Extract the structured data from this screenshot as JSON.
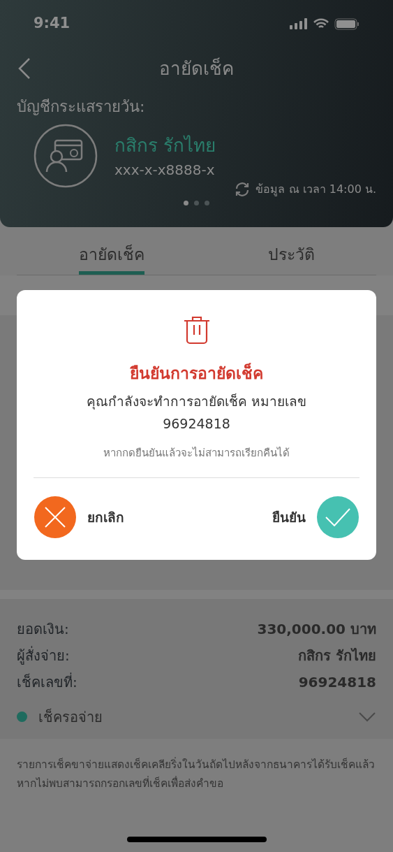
{
  "status_bar": {
    "time": "9:41"
  },
  "header": {
    "title": "อายัดเช็ค",
    "account_label": "บัญชีกระแสรายวัน:",
    "account_name": "กสิกร รักไทย",
    "account_number": "xxx-x-x8888-x",
    "updated": "ข้อมูล ณ เวลา 14:00 น.",
    "pages": [
      {
        "selected": true
      },
      {
        "selected": false
      },
      {
        "selected": false
      }
    ]
  },
  "tabs": [
    {
      "label": "อายัดเช็ค",
      "selected": true
    },
    {
      "label": "ประวัติ",
      "selected": false
    }
  ],
  "details": {
    "rows": [
      {
        "label": "ยอดเงิน:",
        "value": "330,000.00 บาท"
      },
      {
        "label": "ผู้สั่งจ่าย:",
        "value": "กสิกร รักไทย"
      },
      {
        "label": "เช็คเลขที่:",
        "value": "96924818"
      }
    ],
    "status": {
      "label": "เช็ครอจ่าย",
      "color": "#1f6b5e"
    }
  },
  "note": "รายการเช็คขาจ่ายแสดงเช็คเคลียริ่งในวันถัดไปหลังจากธนาคารได้รับเช็คแล้ว หากไม่พบสามารถกรอกเลขที่เช็คเพื่อส่งคำขอ",
  "dialog": {
    "title": "ยืนยันการอายัดเช็ค",
    "message": "คุณกำลังจะทำการอายัดเช็ค หมายเลข",
    "number": "96924818",
    "warning": "หากกดยืนยันแล้วจะไม่สามารถเรียกคืนได้",
    "cancel": "ยกเลิก",
    "confirm": "ยืนยัน"
  }
}
